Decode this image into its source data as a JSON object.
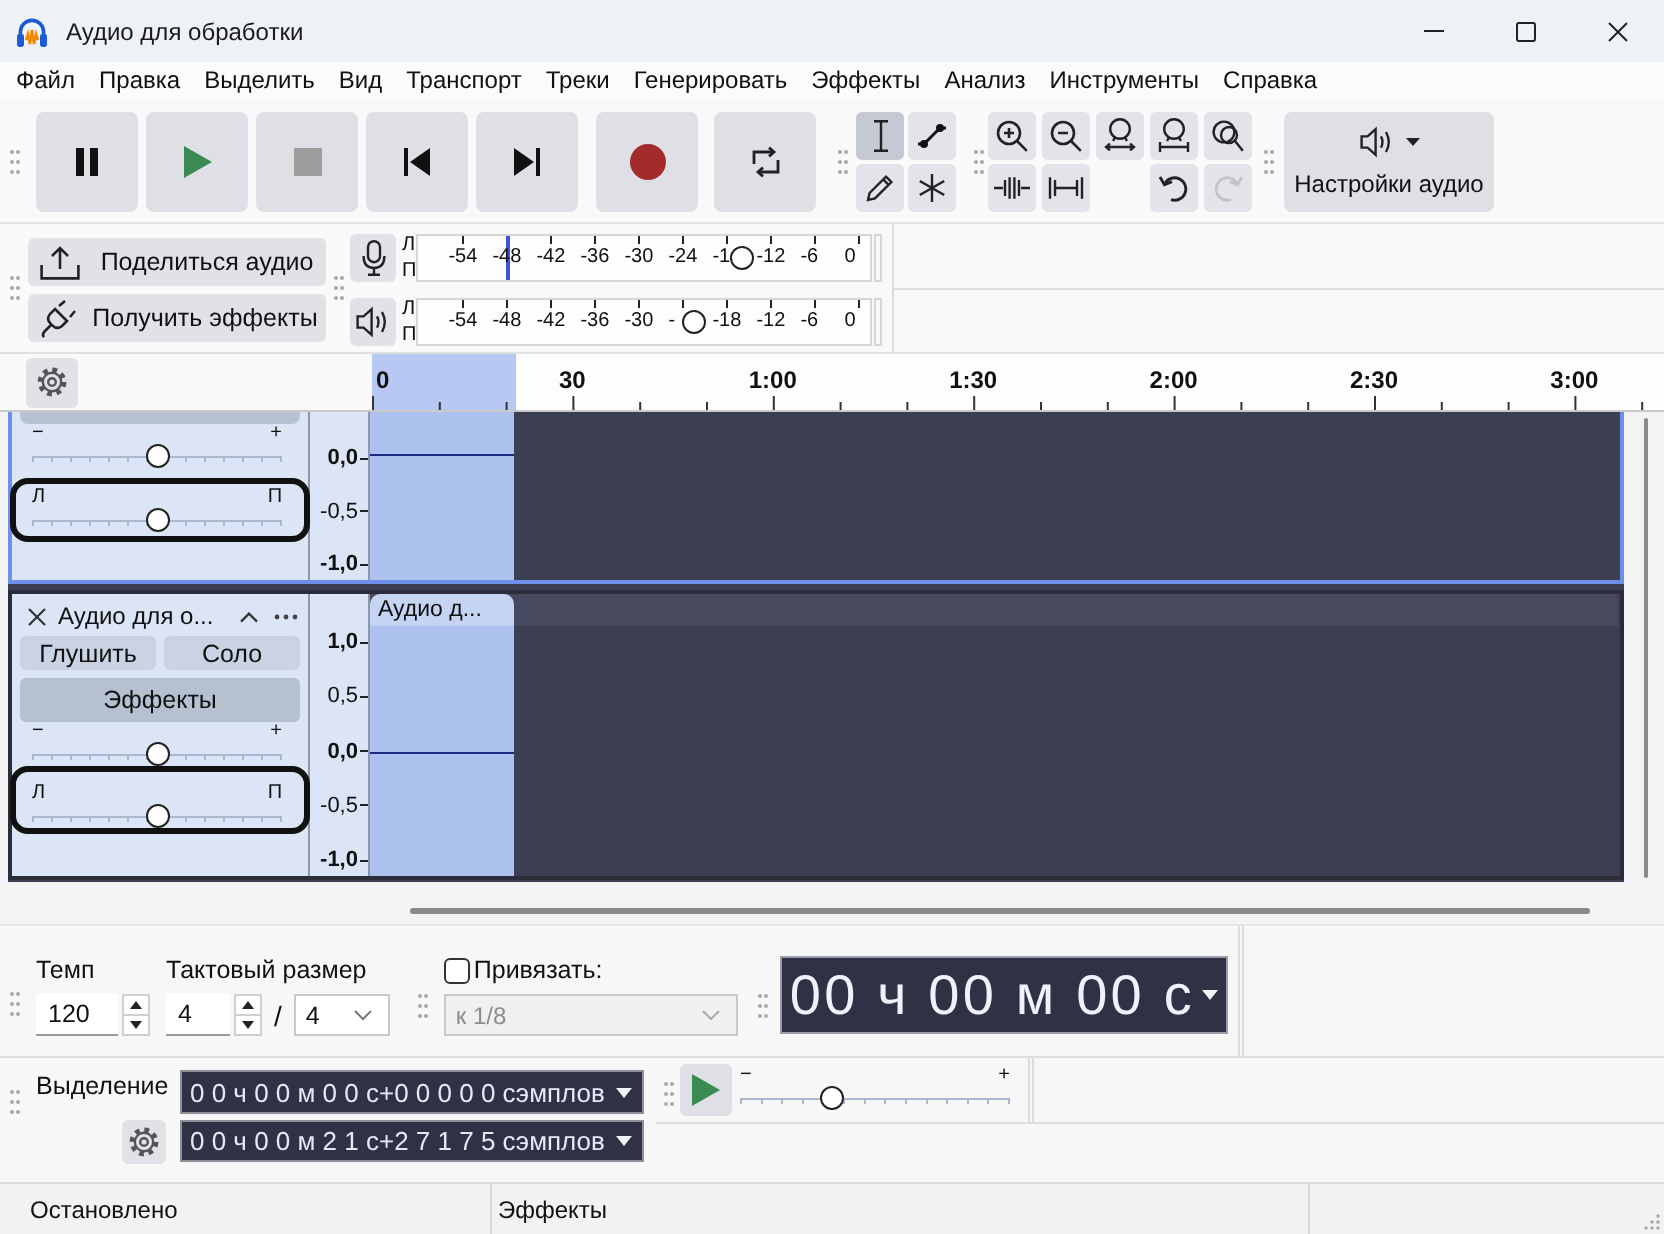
{
  "window": {
    "title": "Аудио для обработки"
  },
  "menu": [
    "Файл",
    "Правка",
    "Выделить",
    "Вид",
    "Транспорт",
    "Треки",
    "Генерировать",
    "Эффекты",
    "Анализ",
    "Инструменты",
    "Справка"
  ],
  "transport": [
    {
      "kind": "pause"
    },
    {
      "kind": "play"
    },
    {
      "kind": "stop"
    },
    {
      "kind": "skip-start"
    },
    {
      "kind": "skip-end"
    },
    {
      "kind": "record"
    },
    {
      "kind": "loop"
    }
  ],
  "tools": [
    {
      "kind": "select",
      "selected": true
    },
    {
      "kind": "envelope",
      "selected": false
    },
    {
      "kind": "draw",
      "selected": false
    },
    {
      "kind": "multi",
      "selected": false
    }
  ],
  "zoom_tools": [
    {
      "kind": "zoom-in"
    },
    {
      "kind": "zoom-out"
    },
    {
      "kind": "fit-selection"
    },
    {
      "kind": "fit-project"
    },
    {
      "kind": "zoom-toggle"
    }
  ],
  "edit_tools": [
    {
      "kind": "trim"
    },
    {
      "kind": "silence"
    }
  ],
  "history": [
    {
      "kind": "undo",
      "disabled": false
    },
    {
      "kind": "redo",
      "disabled": true
    }
  ],
  "audio_setup": {
    "label": "Настройки аудио"
  },
  "actions": [
    {
      "kind": "share",
      "label": "Поделиться аудио"
    },
    {
      "kind": "plugins",
      "label": "Получить эффекты"
    }
  ],
  "meters": [
    {
      "kind": "record",
      "channels": [
        "Л",
        "П"
      ],
      "ticks": [
        "-54",
        "-48",
        "-42",
        "-36",
        "-30",
        "-24",
        "-1",
        "-12",
        "-6",
        "0"
      ],
      "level": 0.2,
      "volume": {
        "level": 0.735
      }
    },
    {
      "kind": "playback",
      "channels": [
        "Л",
        "П"
      ],
      "ticks": [
        "-54",
        "-48",
        "-42",
        "-36",
        "-30",
        "-",
        "-18",
        "-12",
        "-6",
        "0"
      ],
      "volume": {
        "level": 0.625
      }
    }
  ],
  "ruler": {
    "labels": [
      "0",
      "30",
      "1:00",
      "1:30",
      "2:00",
      "2:30",
      "3:00"
    ],
    "selection": {
      "level": 0.115
    }
  },
  "tracks": [
    {
      "selected": true,
      "gain": {
        "minus": "−",
        "plus": "+",
        "level": 0.5
      },
      "pan": {
        "left": "Л",
        "right": "П",
        "level": 0.5,
        "annotated": true
      },
      "scale": [
        {
          "label": "0,0",
          "major": true
        },
        {
          "label": "-0,5",
          "major": false
        },
        {
          "label": "-1,0",
          "major": true
        }
      ]
    },
    {
      "selected": false,
      "name": "Аудио для о...",
      "buttons": [
        "Глушить",
        "Соло"
      ],
      "effects": "Эффекты",
      "gain": {
        "minus": "−",
        "plus": "+",
        "level": 0.5
      },
      "pan": {
        "left": "Л",
        "right": "П",
        "level": 0.5,
        "annotated": true
      },
      "scale": [
        {
          "label": "1,0",
          "major": true
        },
        {
          "label": "0,5",
          "major": false
        },
        {
          "label": "0,0",
          "major": true
        },
        {
          "label": "-0,5",
          "major": false
        },
        {
          "label": "-1,0",
          "major": true
        }
      ],
      "clip": {
        "title": "Аудио д..."
      }
    }
  ],
  "tempo": {
    "label": "Темп",
    "value": "120"
  },
  "time_signature": {
    "label": "Тактовый размер",
    "upper": "4",
    "separator": "/",
    "lower": "4"
  },
  "snap": {
    "label": "Привязать:",
    "checked": false,
    "value": "к 1/8",
    "disabled": true
  },
  "time": {
    "value": "00 ч 00 м 00 с"
  },
  "selection": {
    "label": "Выделение",
    "start": "0 0 ч 0 0 м 0 0 с+0 0 0 0 0 сэмплов",
    "end": "0 0 ч 0 0 м 2 1 с+2 7 1 7 5 сэмплов"
  },
  "play_at_speed": {
    "minus": "−",
    "plus": "+",
    "level": 0.34
  },
  "status_bar": [
    "Остановлено",
    "Эффекты"
  ]
}
